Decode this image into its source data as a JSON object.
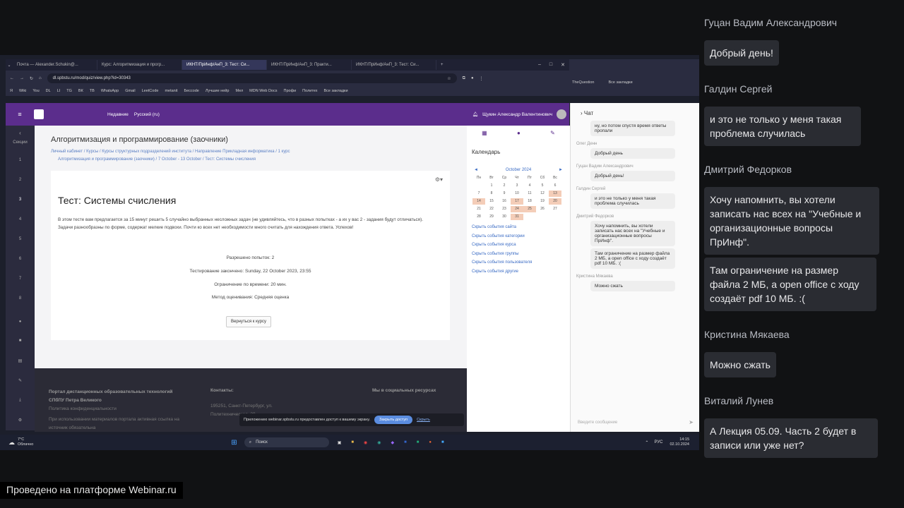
{
  "browser": {
    "tabs": [
      "Почта — Alexander.Schukin@...",
      "Курс: Алгоритмизация и прогр...",
      "ИКНТ/ПрИнф/АнП_3: Тест: Си...",
      "ИКНТ/ПрИнф/АнП_3: Практи...",
      "ИКНТ/ПрИнф/АнП_3: Тест: Си..."
    ],
    "url": "dl.spbstu.ru/mod/quiz/view.php?id=30343",
    "bookmarks": [
      "Я",
      "Wiki",
      "You",
      "DL",
      "LI",
      "TG",
      "ВК",
      "ТВ",
      "WhatsApp",
      "Gmail",
      "LeetCode",
      "metanit",
      "Бесcode",
      "Лучшие нейр",
      "Мел",
      "MDN Web Docs",
      "Профи",
      "Политех",
      "Все закладки"
    ],
    "second_bookmarks": [
      "TheQuestion",
      "Все закладки"
    ]
  },
  "moodle": {
    "nav_notifications": "Недавние",
    "language": "Русский (ru)",
    "user": "Щукин Александр Валентинович",
    "left_label": "Секции",
    "sections": [
      "1",
      "2",
      "3",
      "4",
      "5",
      "6",
      "7",
      "8"
    ],
    "course_title": "Алгоритмизация и программирование (заочники)",
    "breadcrumb_1": "Личный кабинет / Курсы / Курсы структурных подразделений института / Направление Прикладная информатика / 1 курс",
    "breadcrumb_2": "Алгоритмизация и программирование (заочники) / 7 October - 13 October / Тест: Системы счисления",
    "quiz_title": "Тест: Системы счисления",
    "quiz_desc": "В этом тесте вам предлагается за 15 минут решить 5 случайно выбранных несложных задач (не удивляйтесь, что в разных попытках - а их у вас 2 - задания будут отличаться). Задачи разнообразны по форме, содержат мелкие подвохи. Почти ко всех нет необходимости много считать для нахождения ответа. Успехов!",
    "attempts": "Разрешено попыток: 2",
    "closed": "Тестирование закончено: Sunday, 22 October 2023, 23:55",
    "time_limit": "Ограничение по времени: 20 мин.",
    "grading": "Метод оценивания: Средняя оценка",
    "back_button": "Вернуться к курсу",
    "footer_org": "Портал дистанционных образовательных технологий СПбПУ Петра Великого",
    "footer_privacy": "Политика конфиденциальности",
    "footer_note": "При использовании материалов портала активная ссылка на источник обязательна",
    "footer_contacts": "Контакты:",
    "footer_address": "195251, Санкт-Петербург, ул. Политехническая, 29",
    "footer_social": "Мы в социальных ресурсах",
    "share_notice": "Приложению webinar.spbstu.ru предоставлен доступ к вашему экрану.",
    "share_stop": "Закрыть доступ",
    "share_hide": "Скрыть"
  },
  "calendar": {
    "title": "Календарь",
    "month": "October 2024",
    "weekdays": [
      "Пн",
      "Вт",
      "Ср",
      "Чт",
      "Пт",
      "Сб",
      "Вс"
    ],
    "days": [
      "",
      "1",
      "2",
      "3",
      "4",
      "5",
      "6",
      "7",
      "8",
      "9",
      "10",
      "11",
      "12",
      "13",
      "14",
      "15",
      "16",
      "17",
      "18",
      "19",
      "20",
      "21",
      "22",
      "23",
      "24",
      "25",
      "26",
      "27",
      "28",
      "29",
      "30",
      "31",
      "",
      "",
      ""
    ],
    "highlighted": [
      "13",
      "14",
      "17",
      "20",
      "24",
      "25",
      "31"
    ],
    "filters": [
      "Скрыть события сайта",
      "Скрыть события категории",
      "Скрыть события курса",
      "Скрыть события группы",
      "Скрыть события пользователя",
      "Скрыть события другие"
    ]
  },
  "inner_chat": {
    "title": "Чат",
    "messages": [
      {
        "name": "",
        "text": "ну, но потом спустя время ответы пропали"
      },
      {
        "name": "Олег Денн",
        "text": "Добрый день"
      },
      {
        "name": "Гуцан Вадим Александрович",
        "text": "Добрый день!"
      },
      {
        "name": "Галдин Сергей",
        "text": "и это не только у меня такая проблема случилась"
      },
      {
        "name": "Дмитрий Федорков",
        "text": "Хочу напомнить, вы хотели записать нас всех на \"Учебные и организационные вопросы ПрИнф\"."
      },
      {
        "name": "",
        "text": "Там ограничение на размер файла 2 МБ, а open office с ходу создаёт pdf 10 МБ. :("
      },
      {
        "name": "Кристина Мякаева",
        "text": "Можно сжать"
      },
      {
        "name": "Виталий Лунев",
        "text": "А Лекция 05.09. Часть 2 будет в записи или уже нет?"
      }
    ],
    "input_placeholder": "Введите сообщение"
  },
  "taskbar": {
    "weather": "7°C",
    "weather_desc": "Облачно",
    "search": "Поиск",
    "lang": "РУС",
    "time": "14:15",
    "date": "02.10.2024"
  },
  "meeting_chat": [
    {
      "name": "Гуцан Вадим Александрович",
      "text": "Добрый день!"
    },
    {
      "name": "Галдин Сергей",
      "text": "и это не только у меня такая проблема случилась"
    },
    {
      "name": "Дмитрий Федорков",
      "text": "Хочу напомнить, вы хотели записать нас всех на \"Учебные и организационные вопросы ПрИнф\"."
    },
    {
      "name": "",
      "text": "Там ограничение на размер файла 2 МБ, а open office с ходу создаёт pdf 10 МБ. :("
    },
    {
      "name": "Кристина Мякаева",
      "text": "Можно сжать"
    },
    {
      "name": "Виталий Лунев",
      "text": "А Лекция 05.09. Часть 2 будет  в записи или уже нет?"
    }
  ],
  "platform_tag": "Проведено на платформе Webinar.ru"
}
